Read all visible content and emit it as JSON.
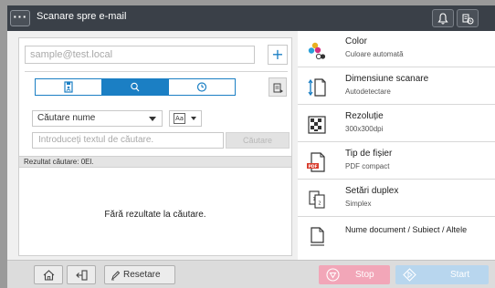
{
  "header": {
    "menu_label": "···",
    "title": "Scanare spre e-mail"
  },
  "address": {
    "placeholder": "sample@test.local",
    "add_label": "+"
  },
  "search": {
    "type_label": "Căutare nume",
    "case_label": "Aa",
    "input_placeholder": "Introduceți textul de căutare.",
    "button_label": "Căutare",
    "result_label": "Rezultat căutare: 0El.",
    "no_results": "Fără rezultate la căutare."
  },
  "settings": [
    {
      "name": "Color",
      "value": "Culoare automată",
      "icon": "color-icon"
    },
    {
      "name": "Dimensiune scanare",
      "value": "Autodetectare",
      "icon": "scan-size-icon"
    },
    {
      "name": "Rezoluție",
      "value": "300x300dpi",
      "icon": "resolution-icon"
    },
    {
      "name": "Tip de fișier",
      "value": "PDF compact",
      "icon": "pdf-file-icon",
      "badge": "PDF"
    },
    {
      "name": "Setări duplex",
      "value": "Simplex",
      "icon": "duplex-icon",
      "page_labels": [
        "1",
        "2"
      ]
    },
    {
      "name": "Nume document / Subiect / Altele",
      "value": "",
      "icon": "document-icon"
    }
  ],
  "footer": {
    "reset_label": "Resetare",
    "stop_label": "Stop",
    "start_label": "Start"
  },
  "colors": {
    "accent": "#1b7fc4",
    "topbar": "#3a4048",
    "stop": "#f2a6b8",
    "start": "#b8d6ee"
  }
}
